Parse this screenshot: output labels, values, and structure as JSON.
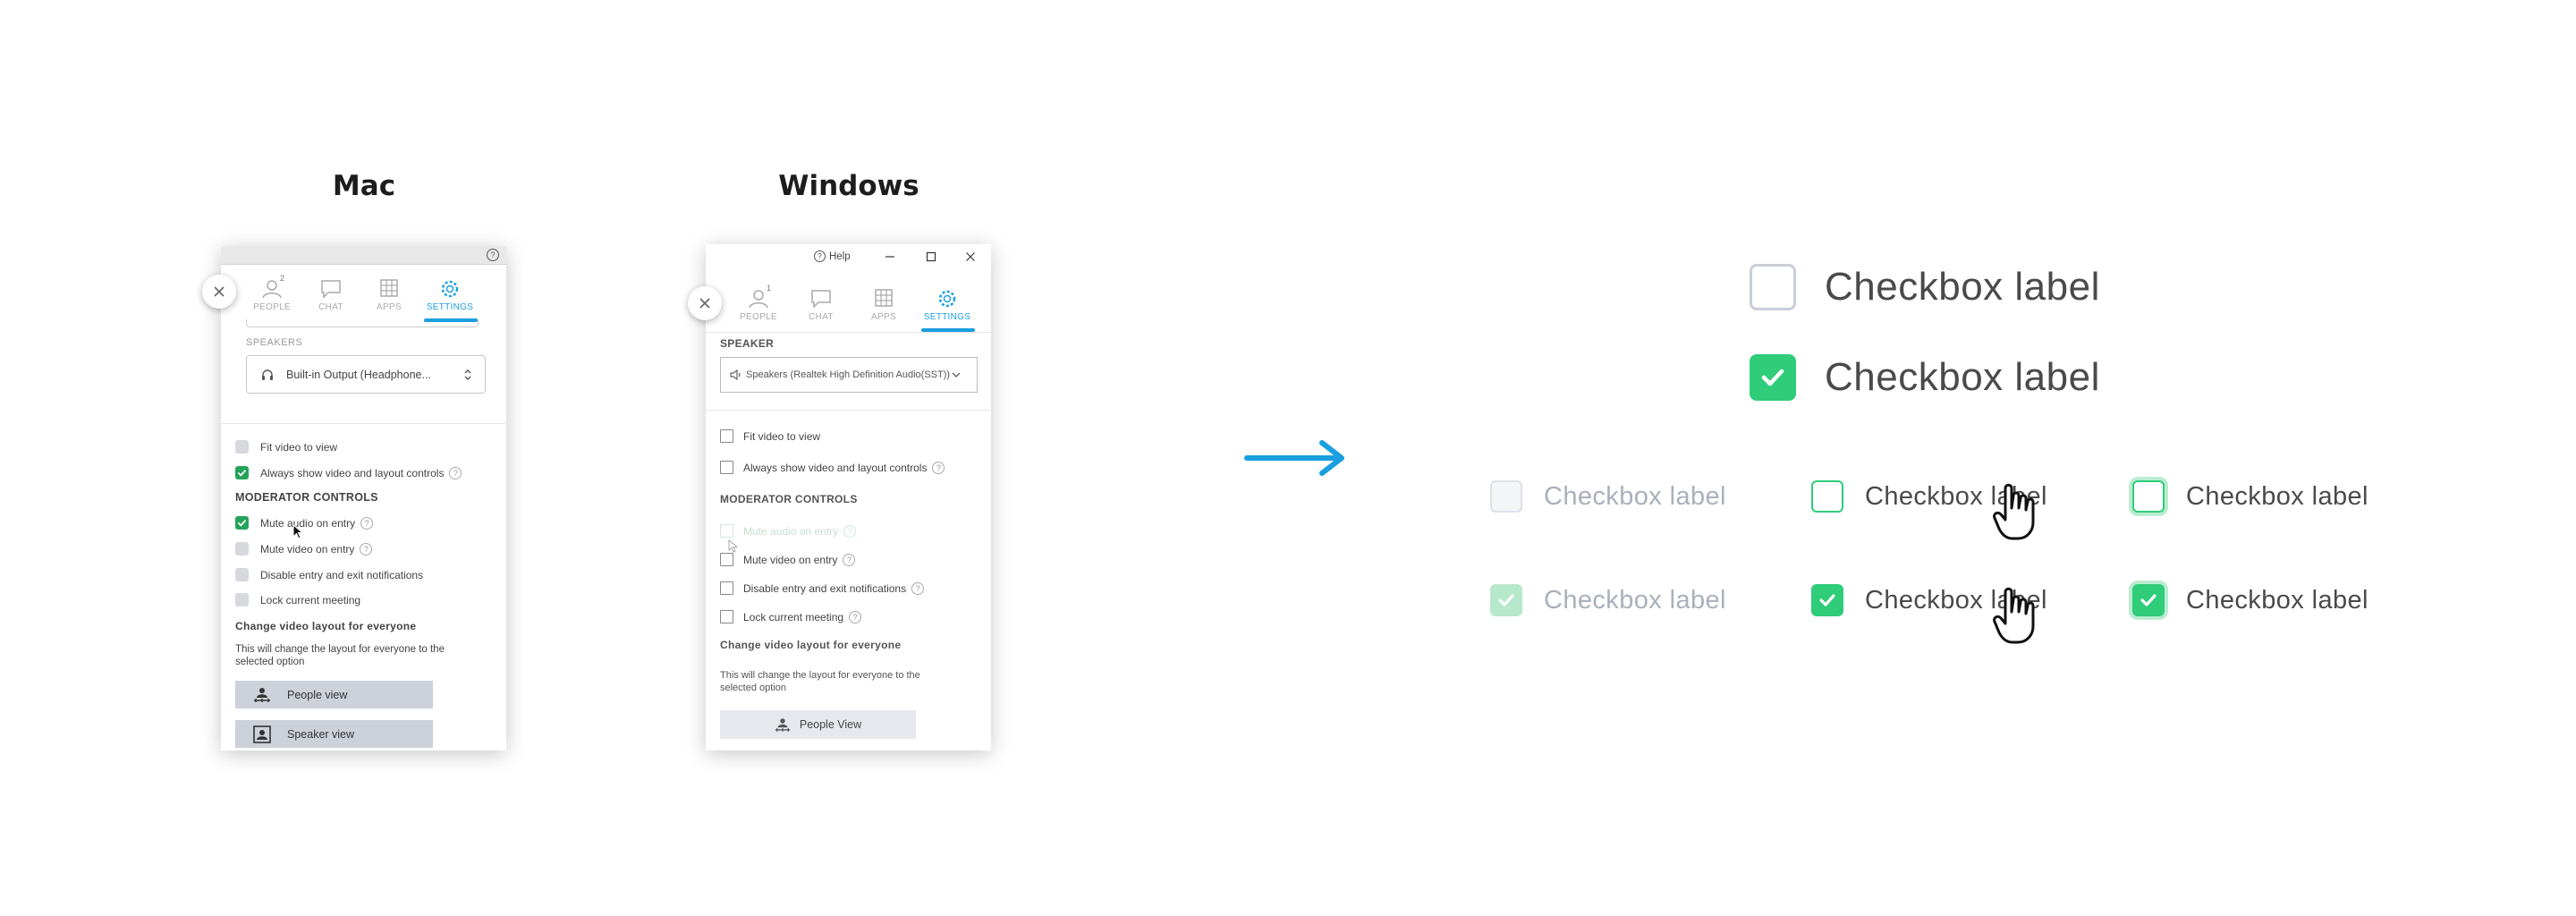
{
  "titles": {
    "mac": "Mac",
    "windows": "Windows"
  },
  "tabs": [
    {
      "label": "PEOPLE",
      "badge": "2"
    },
    {
      "label": "CHAT"
    },
    {
      "label": "APPS"
    },
    {
      "label": "SETTINGS"
    }
  ],
  "mac": {
    "speakers_label": "SPEAKERS",
    "speaker_value": "Built-in Output (Headphone...",
    "options": [
      {
        "label": "Fit video to view",
        "checked": false
      },
      {
        "label": "Always show video and layout controls",
        "checked": true
      }
    ],
    "moderator_heading": "MODERATOR CONTROLS",
    "moderator_options": [
      {
        "label": "Mute audio on entry",
        "checked": true
      },
      {
        "label": "Mute video on entry",
        "checked": false
      },
      {
        "label": "Disable entry and exit notifications",
        "checked": false
      },
      {
        "label": "Lock current meeting",
        "checked": false
      }
    ],
    "layout_heading": "Change video layout for everyone",
    "layout_desc": "This will change the layout for everyone to the selected option",
    "people_view": "People view",
    "speaker_view": "Speaker view"
  },
  "windows": {
    "help_label": "Help",
    "people_badge": "1",
    "speaker_label": "SPEAKER",
    "speaker_value": "Speakers (Realtek High Definition Audio(SST))",
    "options": [
      {
        "label": "Fit video to view"
      },
      {
        "label": "Always show video and layout controls"
      }
    ],
    "moderator_heading": "MODERATOR CONTROLS",
    "moderator_options": [
      {
        "label": "Mute audio on entry"
      },
      {
        "label": "Mute video on entry"
      },
      {
        "label": "Disable entry and exit notifications"
      },
      {
        "label": "Lock current meeting"
      }
    ],
    "layout_heading": "Change video layout for everyone",
    "layout_desc": "This will change the layout for everyone to the selected option",
    "people_view": "People View"
  },
  "showcase": {
    "label": "Checkbox label",
    "accent_color": "#2fcc7a",
    "arrow_color": "#1a9fe0"
  }
}
